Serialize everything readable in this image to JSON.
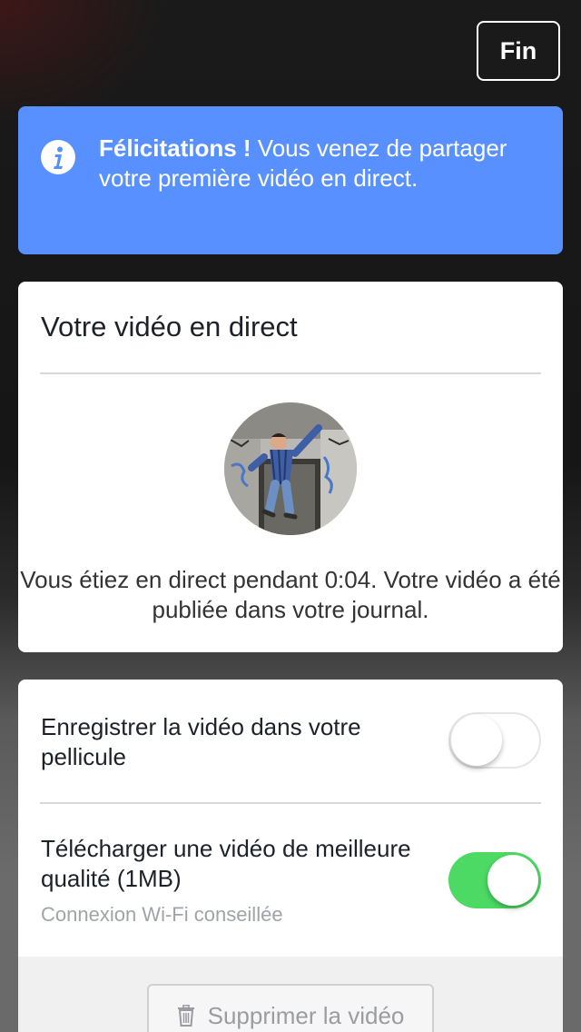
{
  "header": {
    "done_label": "Fin"
  },
  "banner": {
    "icon": "info-icon",
    "bold_text": "Félicitations !",
    "text": " Vous venez de partager votre première vidéo en direct."
  },
  "live_card": {
    "title": "Votre vidéo en direct",
    "thumbnail": "video-thumbnail-avatar",
    "summary": "Vous étiez en direct pendant 0:04. Votre vidéo a été publiée dans votre journal."
  },
  "settings": {
    "save_to_roll": {
      "label": "Enregistrer la vidéo dans votre pellicule",
      "enabled": false
    },
    "hq_upload": {
      "label": "Télécharger une vidéo de meilleure qualité (1MB)",
      "sublabel": "Connexion Wi-Fi conseillée",
      "enabled": true
    }
  },
  "footer": {
    "delete_label": "Supprimer la vidéo",
    "delete_icon": "trash-icon"
  },
  "colors": {
    "banner": "#5890ff",
    "toggle_on": "#4cd964",
    "text": "#1d2129"
  }
}
